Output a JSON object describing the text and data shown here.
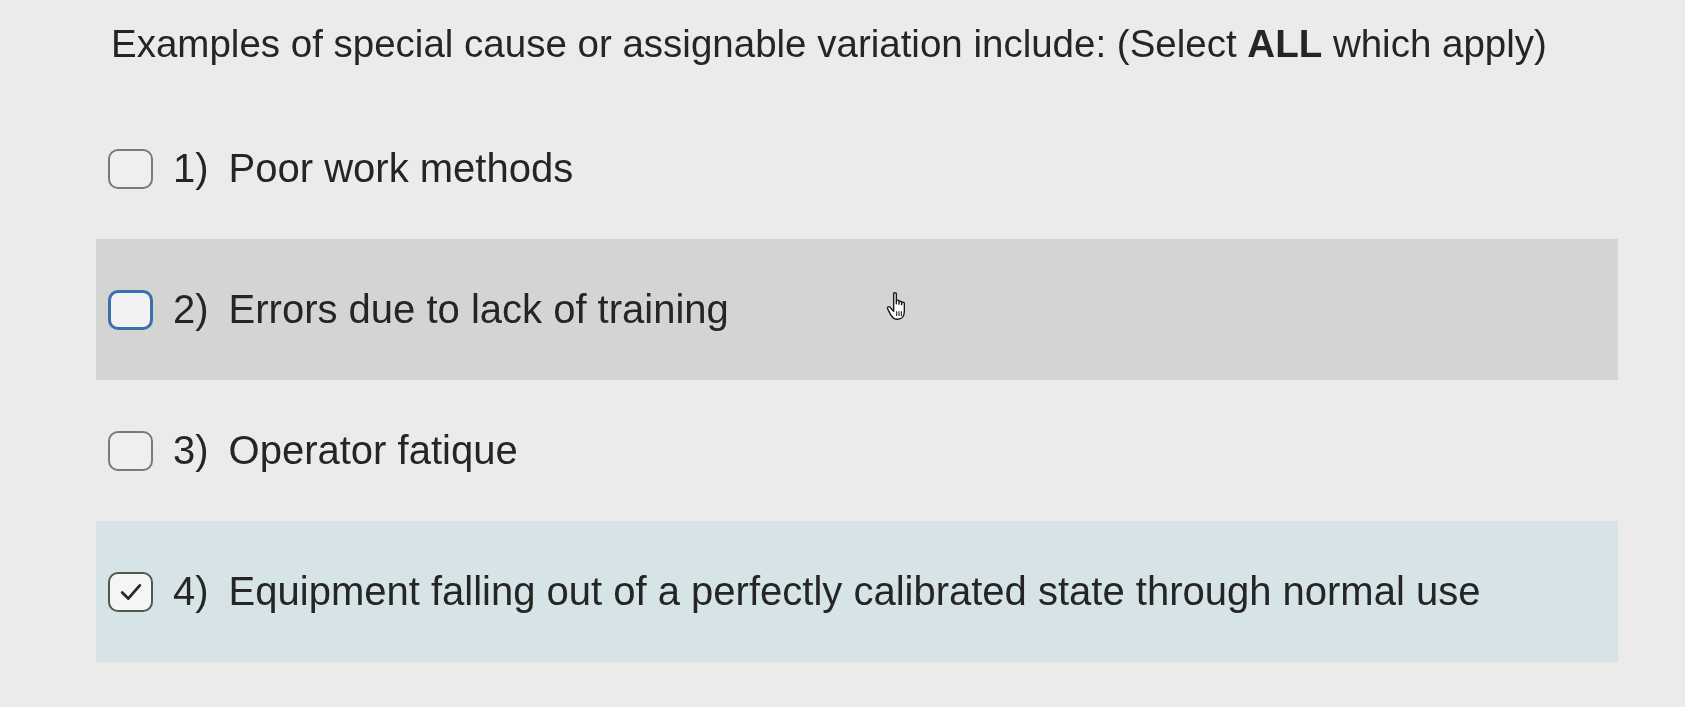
{
  "question": {
    "text": "Examples of special cause or assignable variation include: (Select **ALL** which apply)"
  },
  "options": [
    {
      "number": "1)",
      "label": "Poor work methods",
      "checked": false,
      "hovered": false
    },
    {
      "number": "2)",
      "label": "Errors due to lack of training",
      "checked": false,
      "hovered": true
    },
    {
      "number": "3)",
      "label": "Operator fatique",
      "checked": false,
      "hovered": false
    },
    {
      "number": "4)",
      "label": "Equipment falling out of a perfectly calibrated state through normal use",
      "checked": true,
      "hovered": false
    }
  ]
}
